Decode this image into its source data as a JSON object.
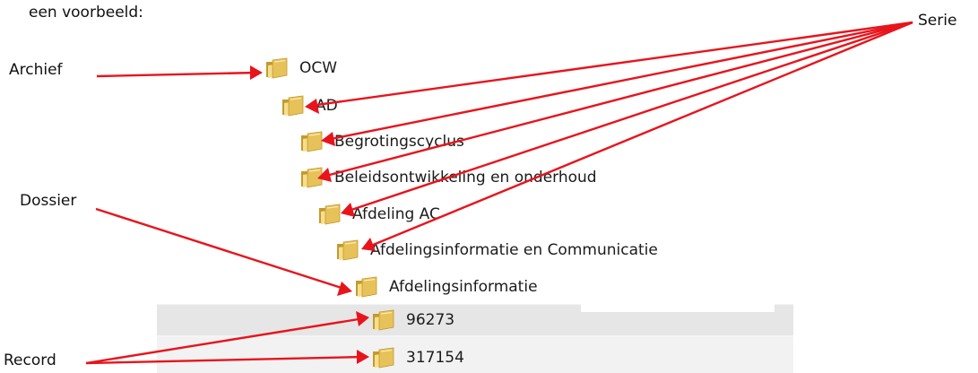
{
  "intro": "een voorbeeld:",
  "labels": {
    "archief": "Archief",
    "dossier": "Dossier",
    "record": "Record",
    "serie": "Serie"
  },
  "colors": {
    "arrow": "#e8141c",
    "folder_main": "#e7c25a",
    "folder_dark": "#c49a2a",
    "folder_light": "#f6de8e"
  },
  "tree": [
    {
      "label": "OCW",
      "icon": "folder-icon"
    },
    {
      "label": "AD",
      "icon": "folder-icon"
    },
    {
      "label": "Begrotingscyclus",
      "icon": "folder-icon"
    },
    {
      "label": "Beleidsontwikkeling en onderhoud",
      "icon": "folder-icon"
    },
    {
      "label": "Afdeling AC",
      "icon": "folder-icon"
    },
    {
      "label": "Afdelingsinformatie en Communicatie",
      "icon": "folder-icon"
    },
    {
      "label": "Afdelingsinformatie",
      "icon": "folder-icon"
    },
    {
      "label": "96273",
      "icon": "folder-icon"
    },
    {
      "label": "317154",
      "icon": "folder-icon"
    }
  ]
}
